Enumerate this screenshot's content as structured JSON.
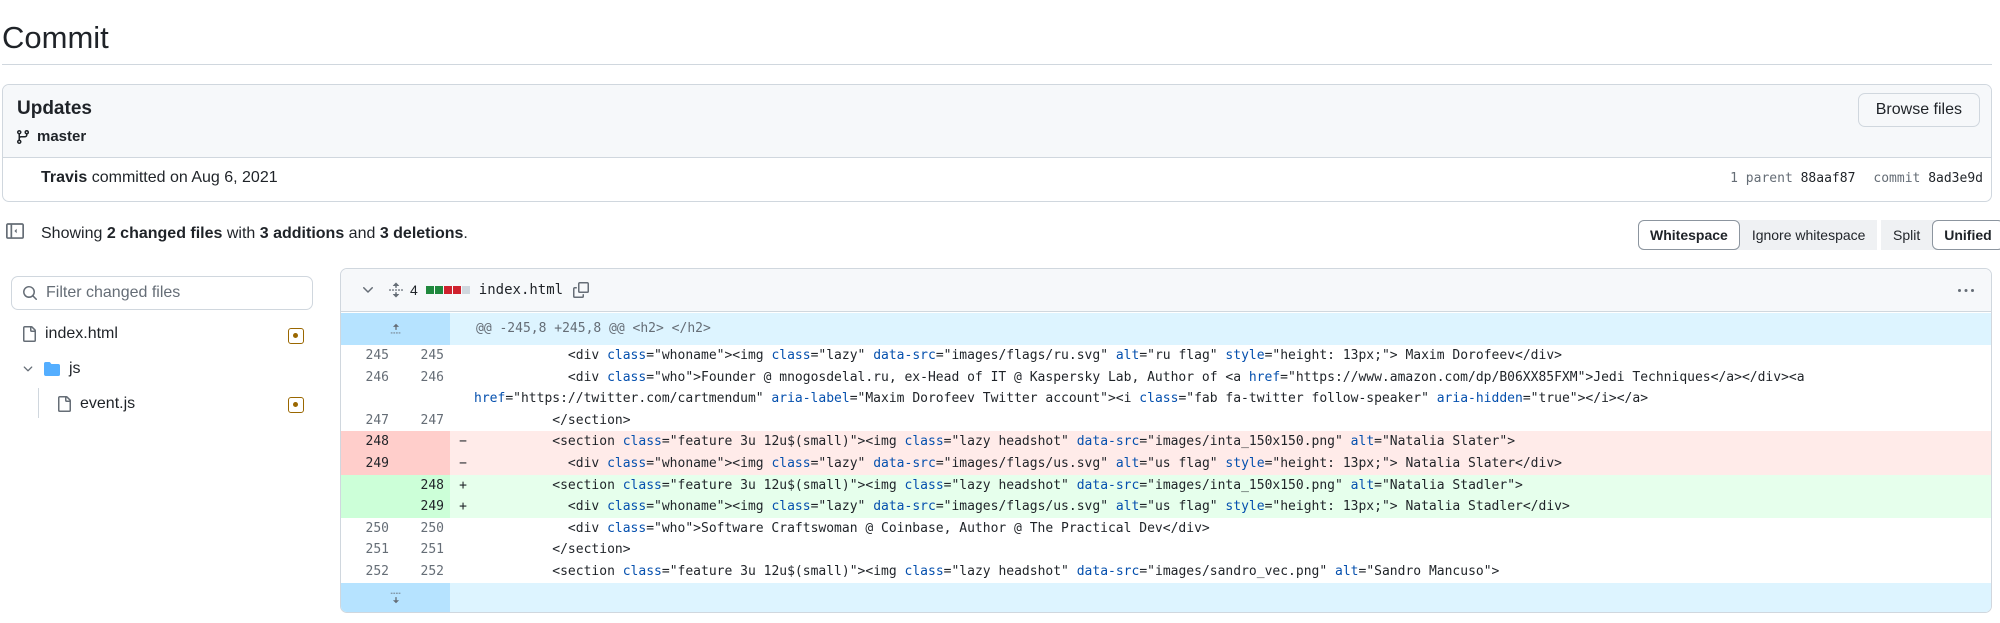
{
  "page": {
    "title": "Commit"
  },
  "commit": {
    "message": "Updates",
    "branch": "master",
    "browse_label": "Browse files",
    "author": "Travis",
    "committed_text": " committed on Aug 6, 2021",
    "parent_count_label": "1 parent",
    "parent_sha": "88aaf87",
    "commit_label": "commit",
    "commit_sha": "8ad3e9d"
  },
  "summary": {
    "prefix": "Showing ",
    "changed": "2 changed files",
    "mid1": " with ",
    "additions": "3 additions",
    "mid2": " and ",
    "deletions": "3 deletions",
    "suffix": "."
  },
  "toolbar": {
    "whitespace_label": "Whitespace",
    "ignore_whitespace_label": "Ignore whitespace",
    "split_label": "Split",
    "unified_label": "Unified"
  },
  "filetree": {
    "filter_placeholder": "Filter changed files",
    "items": [
      {
        "label": "index.html"
      },
      {
        "label": "js"
      },
      {
        "label": "event.js"
      }
    ]
  },
  "diff": {
    "change_count": "4",
    "filename": "index.html",
    "diffstat_colors": [
      "#1f883d",
      "#1f883d",
      "#cf222e",
      "#cf222e",
      "#d0d7de"
    ],
    "hunk_header": "@@ -245,8 +245,8 @@ <h2> </h2>",
    "lines": [
      {
        "type": "ctx",
        "old": "245",
        "new": "245",
        "sign": "",
        "code": "            <div class=\"whoname\"><img class=\"lazy\" data-src=\"images/flags/ru.svg\" alt=\"ru flag\" style=\"height: 13px;\"> Maxim Dorofeev</div>"
      },
      {
        "type": "ctx2",
        "old": "246",
        "new": "246",
        "sign": "",
        "code": "            <div class=\"who\">Founder @ mnogosdelal.ru, ex-Head of IT @ Kaspersky Lab, Author of <a href=\"https://www.amazon.com/dp/B06XX85FXM\">Jedi Techniques</a></div><a href=\"https://twitter.com/cartmendum\" aria-label=\"Maxim Dorofeev Twitter account\"><i class=\"fab fa-twitter follow-speaker\" aria-hidden=\"true\"></i></a>"
      },
      {
        "type": "ctx",
        "old": "247",
        "new": "247",
        "sign": "",
        "code": "          </section>"
      },
      {
        "type": "del",
        "old": "248",
        "new": "",
        "sign": "−",
        "code": "          <section class=\"feature 3u 12u$(small)\"><img class=\"lazy headshot\" data-src=\"images/inta_150x150.png\" alt=\"Natalia Slater\">"
      },
      {
        "type": "del",
        "old": "249",
        "new": "",
        "sign": "−",
        "code": "            <div class=\"whoname\"><img class=\"lazy\" data-src=\"images/flags/us.svg\" alt=\"us flag\" style=\"height: 13px;\"> Natalia Slater</div>"
      },
      {
        "type": "add",
        "old": "",
        "new": "248",
        "sign": "+",
        "code": "          <section class=\"feature 3u 12u$(small)\"><img class=\"lazy headshot\" data-src=\"images/inta_150x150.png\" alt=\"Natalia Stadler\">"
      },
      {
        "type": "add",
        "old": "",
        "new": "249",
        "sign": "+",
        "code": "            <div class=\"whoname\"><img class=\"lazy\" data-src=\"images/flags/us.svg\" alt=\"us flag\" style=\"height: 13px;\"> Natalia Stadler</div>"
      },
      {
        "type": "ctx",
        "old": "250",
        "new": "250",
        "sign": "",
        "code": "            <div class=\"who\">Software Craftswoman @ Coinbase, Author @ The Practical Dev</div>"
      },
      {
        "type": "ctx",
        "old": "251",
        "new": "251",
        "sign": "",
        "code": "          </section>"
      },
      {
        "type": "ctx",
        "old": "252",
        "new": "252",
        "sign": "",
        "code": "          <section class=\"feature 3u 12u$(small)\"><img class=\"lazy headshot\" data-src=\"images/sandro_vec.png\" alt=\"Sandro Mancuso\">"
      }
    ]
  }
}
